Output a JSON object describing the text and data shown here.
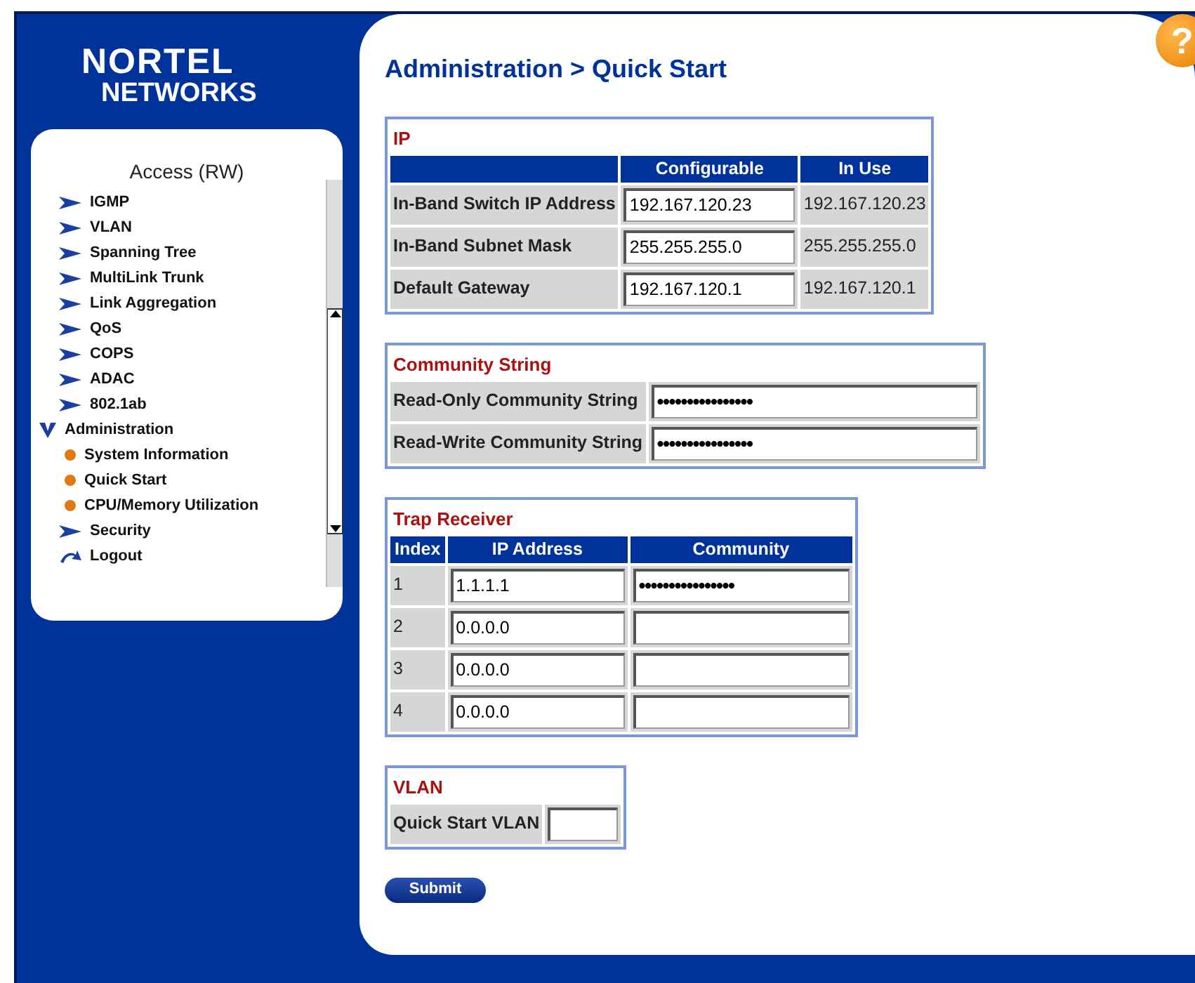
{
  "logo": {
    "line_1": "NORTEL",
    "line_2": "NETWORKS"
  },
  "help_button": {
    "label": "?"
  },
  "sidebar": {
    "title": "Access (RW)",
    "items": [
      {
        "kind": "folder",
        "label": "IGMP",
        "expanded": false
      },
      {
        "kind": "folder",
        "label": "VLAN",
        "expanded": false
      },
      {
        "kind": "folder",
        "label": "Spanning Tree",
        "expanded": false
      },
      {
        "kind": "folder",
        "label": "MultiLink Trunk",
        "expanded": false
      },
      {
        "kind": "folder",
        "label": "Link Aggregation",
        "expanded": false
      },
      {
        "kind": "folder",
        "label": "QoS",
        "expanded": false
      },
      {
        "kind": "folder",
        "label": "COPS",
        "expanded": false
      },
      {
        "kind": "folder",
        "label": "ADAC",
        "expanded": false
      },
      {
        "kind": "folder",
        "label": "802.1ab",
        "expanded": false
      },
      {
        "kind": "folder",
        "label": "Administration",
        "expanded": true,
        "children": [
          {
            "kind": "page",
            "label": "System Information"
          },
          {
            "kind": "page",
            "label": "Quick Start"
          },
          {
            "kind": "page",
            "label": "CPU/Memory Utilization"
          }
        ]
      },
      {
        "kind": "folder",
        "label": "Security",
        "expanded": false
      },
      {
        "kind": "logout",
        "label": "Logout"
      }
    ]
  },
  "page_title": "Administration > Quick Start",
  "ip_section": {
    "title": "IP",
    "columns": [
      "Configurable",
      "In Use"
    ],
    "rows": [
      {
        "label": "In-Band Switch IP Address",
        "configurable": "192.167.120.23",
        "in_use": "192.167.120.23"
      },
      {
        "label": "In-Band Subnet Mask",
        "configurable": "255.255.255.0",
        "in_use": "255.255.255.0"
      },
      {
        "label": "Default Gateway",
        "configurable": "192.167.120.1",
        "in_use": "192.167.120.1"
      }
    ]
  },
  "community_section": {
    "title": "Community String",
    "rows": [
      {
        "label": "Read-Only Community String",
        "value": "••••••••••••••••"
      },
      {
        "label": "Read-Write Community String",
        "value": "••••••••••••••••"
      }
    ]
  },
  "trap_section": {
    "title": "Trap Receiver",
    "columns": [
      "Index",
      "IP Address",
      "Community"
    ],
    "rows": [
      {
        "index": "1",
        "ip_address": "1.1.1.1",
        "community": "••••••••••••••••"
      },
      {
        "index": "2",
        "ip_address": "0.0.0.0"
      },
      {
        "index": "3",
        "ip_address": "0.0.0.0"
      },
      {
        "index": "4",
        "ip_address": "0.0.0.0"
      }
    ]
  },
  "vlan_section": {
    "title": "VLAN",
    "label": "Quick Start VLAN"
  },
  "submit_button": {
    "label": "Submit"
  }
}
